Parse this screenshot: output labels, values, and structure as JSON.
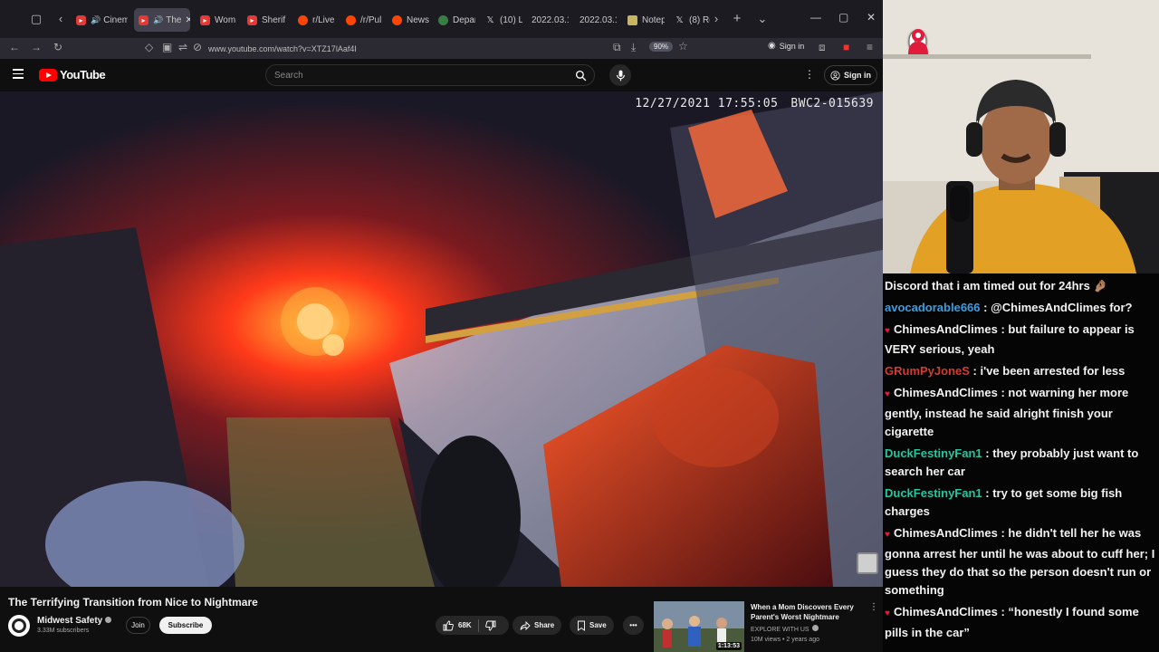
{
  "browser": {
    "tabs": [
      {
        "label": "Cinem",
        "favicon": "youtube-icon",
        "audio": true
      },
      {
        "label": "The",
        "favicon": "youtube-icon",
        "audio": true,
        "active": true
      },
      {
        "label": "Wom",
        "favicon": "youtube-icon"
      },
      {
        "label": "Sherif",
        "favicon": "youtube-icon"
      },
      {
        "label": "r/Live",
        "favicon": "reddit-icon"
      },
      {
        "label": "/r/Pul",
        "favicon": "reddit-icon"
      },
      {
        "label": "News",
        "favicon": "reddit-icon"
      },
      {
        "label": "Depar",
        "favicon": "globe-icon"
      },
      {
        "label": "(10) L",
        "favicon": "x-icon"
      },
      {
        "label": "2022.03.1",
        "favicon": "none"
      },
      {
        "label": "2022.03.1",
        "favicon": "none"
      },
      {
        "label": "Notep",
        "favicon": "notepad-icon"
      },
      {
        "label": "(8) Re",
        "favicon": "x-icon"
      }
    ],
    "url": "www.youtube.com/watch?v=XTZ17lAaf4I",
    "zoom": "90%",
    "sign_in": "Sign in"
  },
  "youtube": {
    "logo_text": "YouTube",
    "search_placeholder": "Search",
    "sign_in": "Sign in"
  },
  "video": {
    "overlay_datetime": "12/27/2021 17:55:05",
    "overlay_camera_id": "BWC2-015639",
    "title": "The Terrifying Transition from Nice to Nightmare",
    "channel": "Midwest Safety",
    "subscribers": "3.33M subscribers",
    "join_label": "Join",
    "subscribe_label": "Subscribe",
    "likes": "68K",
    "share_label": "Share",
    "save_label": "Save"
  },
  "recommended": {
    "title": "When a Mom Discovers Every Parent's Worst Nightmare",
    "channel": "EXPLORE WITH US",
    "meta": "10M views • 2 years ago",
    "duration": "1:13:53"
  },
  "stream": {
    "counter": "0",
    "colors": {
      "accent_red": "#e01b3c",
      "user_blue": "#3e9de0",
      "user_green": "#26c7a0",
      "user_red": "#d43a2f"
    }
  },
  "chat": [
    {
      "user": "",
      "text": "Discord that i am timed out for 24hrs 🤌🏽",
      "color": "#f2f2f2",
      "heart": false
    },
    {
      "user": "avocadorable666",
      "text": ": @ChimesAndClimes for?",
      "color": "#3e9de0",
      "heart": false
    },
    {
      "user": "ChimesAndClimes",
      "text": ": but failure to appear is VERY serious, yeah",
      "color": "#f2f2f2",
      "heart": true
    },
    {
      "user": "GRumPyJoneS",
      "text": ": i've been arrested for less",
      "color": "#d43a2f",
      "heart": false
    },
    {
      "user": "ChimesAndClimes",
      "text": ": not warning her more gently, instead he said alright finish your cigarette",
      "color": "#f2f2f2",
      "heart": true
    },
    {
      "user": "DuckFestinyFan1",
      "text": ": they probably just want to search her car",
      "color": "#26c7a0",
      "heart": false
    },
    {
      "user": "DuckFestinyFan1",
      "text": ": try to get some big fish charges",
      "color": "#26c7a0",
      "heart": false
    },
    {
      "user": "ChimesAndClimes",
      "text": ": he didn't tell her he was gonna arrest her until he was about to cuff her; I guess they do that so the person doesn't run or something",
      "color": "#f2f2f2",
      "heart": true
    },
    {
      "user": "ChimesAndClimes",
      "text": ": “honestly I found some pills in the car”",
      "color": "#f2f2f2",
      "heart": true
    }
  ]
}
